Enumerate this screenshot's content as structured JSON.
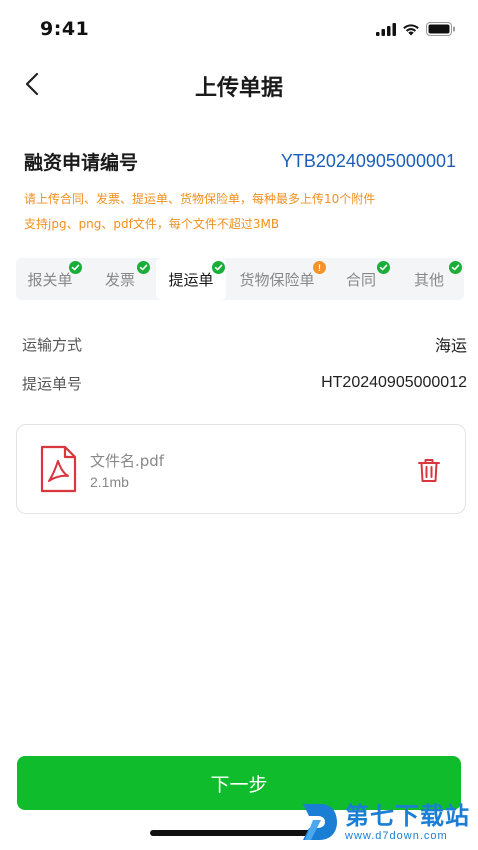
{
  "status_bar": {
    "time": "9:41"
  },
  "nav": {
    "title": "上传单据"
  },
  "application": {
    "label": "融资申请编号",
    "number": "YTB20240905000001"
  },
  "tips": [
    "请上传合同、发票、提运单、货物保险单，每种最多上传10个附件",
    "支持jpg、png、pdf文件，每个文件不超过3MB"
  ],
  "tabs": [
    {
      "label": "报关单",
      "status": "done"
    },
    {
      "label": "发票",
      "status": "done"
    },
    {
      "label": "提运单",
      "status": "done",
      "active": true
    },
    {
      "label": "货物保险单",
      "status": "warning",
      "badge_text": "!"
    },
    {
      "label": "合同",
      "status": "done"
    },
    {
      "label": "其他",
      "status": "done"
    }
  ],
  "details": {
    "transport": {
      "label": "运输方式",
      "value": "海运"
    },
    "bill_no": {
      "label": "提运单号",
      "value": "HT20240905000012"
    }
  },
  "file": {
    "name": "文件名.pdf",
    "size": "2.1mb",
    "icon": "pdf-file-icon"
  },
  "actions": {
    "next_label": "下一步"
  },
  "watermark": {
    "title": "第七下载站",
    "url": "www.d7down.com"
  },
  "colors": {
    "primary_green": "#0fbd2c",
    "link_blue": "#1d5fb8",
    "tip_orange": "#f0901e",
    "delete_red": "#d9363e",
    "warning_badge": "#f5922a"
  }
}
